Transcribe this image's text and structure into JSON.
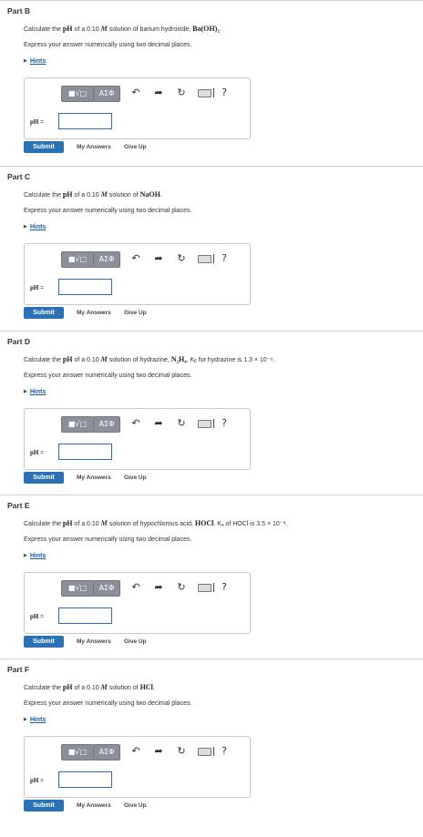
{
  "common": {
    "instruction": "Express your answer numerically using two decimal places.",
    "hints": "Hints",
    "templates_button": "■√□",
    "greek_button": "ΑΣΦ",
    "help": "?",
    "ph_label": "pH =",
    "submit": "Submit",
    "my_answers": "My Answers",
    "give_up": "Give Up",
    "icons": [
      "undo-icon",
      "redo-icon",
      "reset-icon",
      "keyboard-icon",
      "help-icon"
    ]
  },
  "parts": [
    {
      "title": "Part B",
      "q_pre": "Calculate the ",
      "q_ph": "pH",
      "q_mid1": " of a 0.10 ",
      "q_M": "M",
      "q_mid2": " solution of barium hydroxide, ",
      "q_formula": "Ba(OH)₂",
      "q_post": "."
    },
    {
      "title": "Part C",
      "q_pre": "Calculate the ",
      "q_ph": "pH",
      "q_mid1": " of a 0.10 ",
      "q_M": "M",
      "q_mid2": " solution of ",
      "q_formula": "NaOH",
      "q_post": "."
    },
    {
      "title": "Part D",
      "q_pre": "Calculate the ",
      "q_ph": "pH",
      "q_mid1": " of a 0.10 ",
      "q_M": "M",
      "q_mid2": " solution of hydrazine, ",
      "q_formula": "N₂H₄",
      "q_post": ". Kᵦ for hydrazine is 1.3 × 10⁻⁶."
    },
    {
      "title": "Part E",
      "q_pre": "Calculate the ",
      "q_ph": "pH",
      "q_mid1": " of a 0.10 ",
      "q_M": "M",
      "q_mid2": " solution of hypochlorous acid, ",
      "q_formula": "HOCl",
      "q_post": ". Kₐ of HOCl is 3.5 × 10⁻⁸."
    },
    {
      "title": "Part F",
      "q_pre": "Calculate the ",
      "q_ph": "pH",
      "q_mid1": " of a 0.10 ",
      "q_M": "M",
      "q_mid2": " solution of ",
      "q_formula": "HCl",
      "q_post": "."
    }
  ]
}
